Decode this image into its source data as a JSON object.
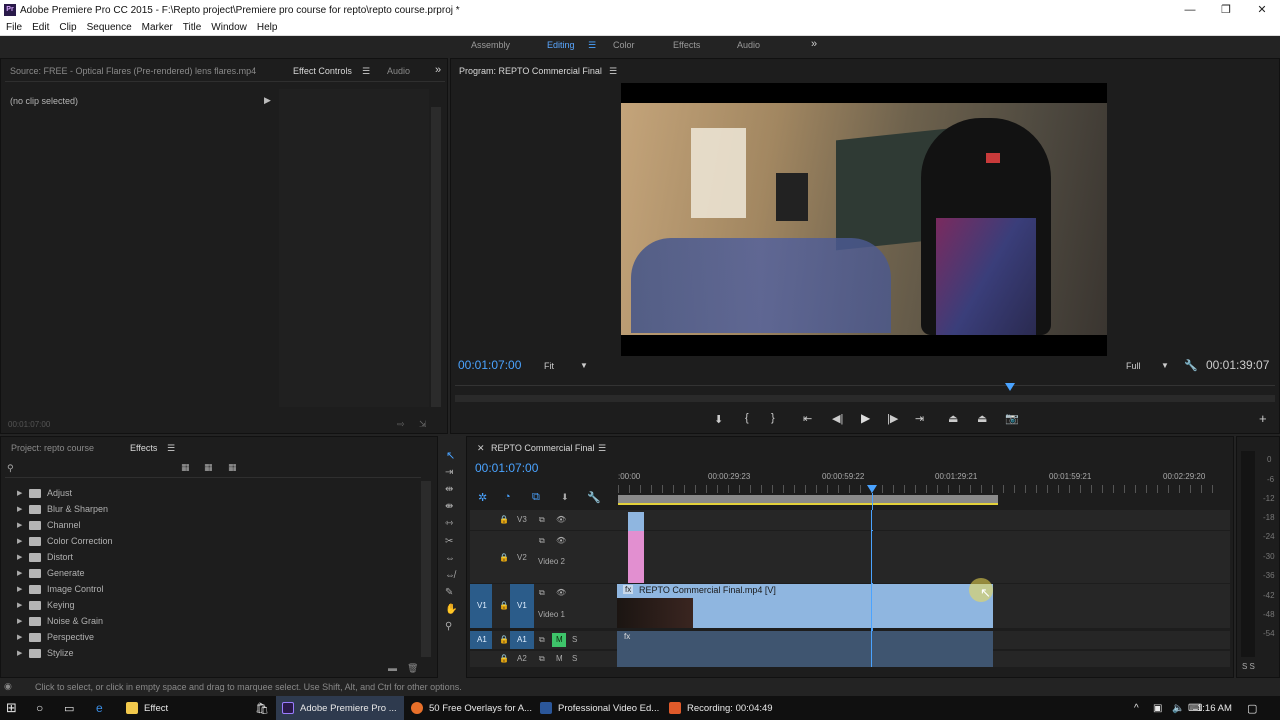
{
  "window": {
    "title": "Adobe Premiere Pro CC 2015 - F:\\Repto project\\Premiere pro course for repto\\repto course.prproj *",
    "app_icon": "Pr",
    "controls": [
      "—",
      "❐",
      "✕"
    ]
  },
  "menu": [
    "File",
    "Edit",
    "Clip",
    "Sequence",
    "Marker",
    "Title",
    "Window",
    "Help"
  ],
  "workspaces": {
    "items": [
      "Assembly",
      "Editing",
      "Color",
      "Effects",
      "Audio"
    ],
    "active": "Editing",
    "overflow": "»"
  },
  "source_panel": {
    "tabs": [
      "Source: FREE - Optical Flares (Pre-rendered) lens flares.mp4",
      "Effect Controls",
      "Audio"
    ],
    "active_tab": "Effect Controls",
    "no_clip": "(no clip selected)",
    "timecode": "00:01:07:00"
  },
  "program_monitor": {
    "title": "Program: REPTO Commercial Final",
    "current_timecode": "00:01:07:00",
    "fit_label": "Fit",
    "quality_label": "Full",
    "duration": "00:01:39:07"
  },
  "project_panel": {
    "tabs": [
      "Project: repto course",
      "Effects"
    ],
    "active_tab": "Effects",
    "effects_folders": [
      "Adjust",
      "Blur & Sharpen",
      "Channel",
      "Color Correction",
      "Distort",
      "Generate",
      "Image Control",
      "Keying",
      "Noise & Grain",
      "Perspective",
      "Stylize"
    ]
  },
  "timeline": {
    "sequence_name": "REPTO Commercial Final",
    "timecode": "00:01:07:00",
    "ruler_labels": [
      ":00:00",
      "00:00:29:23",
      "00:00:59:22",
      "00:01:29:21",
      "00:01:59:21",
      "00:02:29:20"
    ],
    "tracks": {
      "v3": "V3",
      "v2": "V2",
      "v2_name": "Video 2",
      "v1_source": "V1",
      "v1": "V1",
      "v1_name": "Video 1",
      "a1_source": "A1",
      "a1": "A1",
      "a2": "A2",
      "m": "M",
      "s": "S"
    },
    "clip_label": "REPTO Commercial Final.mp4 [V]",
    "fx_badge": "fx"
  },
  "audio_meter": {
    "labels": [
      "0",
      "-6",
      "-12",
      "-18",
      "-24",
      "-30",
      "-36",
      "-42",
      "-48",
      "-54"
    ],
    "solo": "S S"
  },
  "status_bar": "Click to select, or click in empty space and drag to marquee select. Use Shift, Alt, and Ctrl for other options.",
  "taskbar": {
    "items": [
      {
        "label": "Effect",
        "icon": "folder-icon"
      },
      {
        "label": "Adobe Premiere Pro ...",
        "icon": "premiere-icon"
      },
      {
        "label": "50 Free Overlays for A...",
        "icon": "firefox-icon"
      },
      {
        "label": "Professional Video Ed...",
        "icon": "word-icon"
      },
      {
        "label": "Recording:  00:04:49",
        "icon": "recorder-icon"
      }
    ],
    "clock": "1:16 AM"
  },
  "colors": {
    "accent_blue": "#4aa3ff",
    "clip_blue": "#8fb6e0",
    "clip_pink": "#e28fd0",
    "work_area": "#e3d13a"
  }
}
